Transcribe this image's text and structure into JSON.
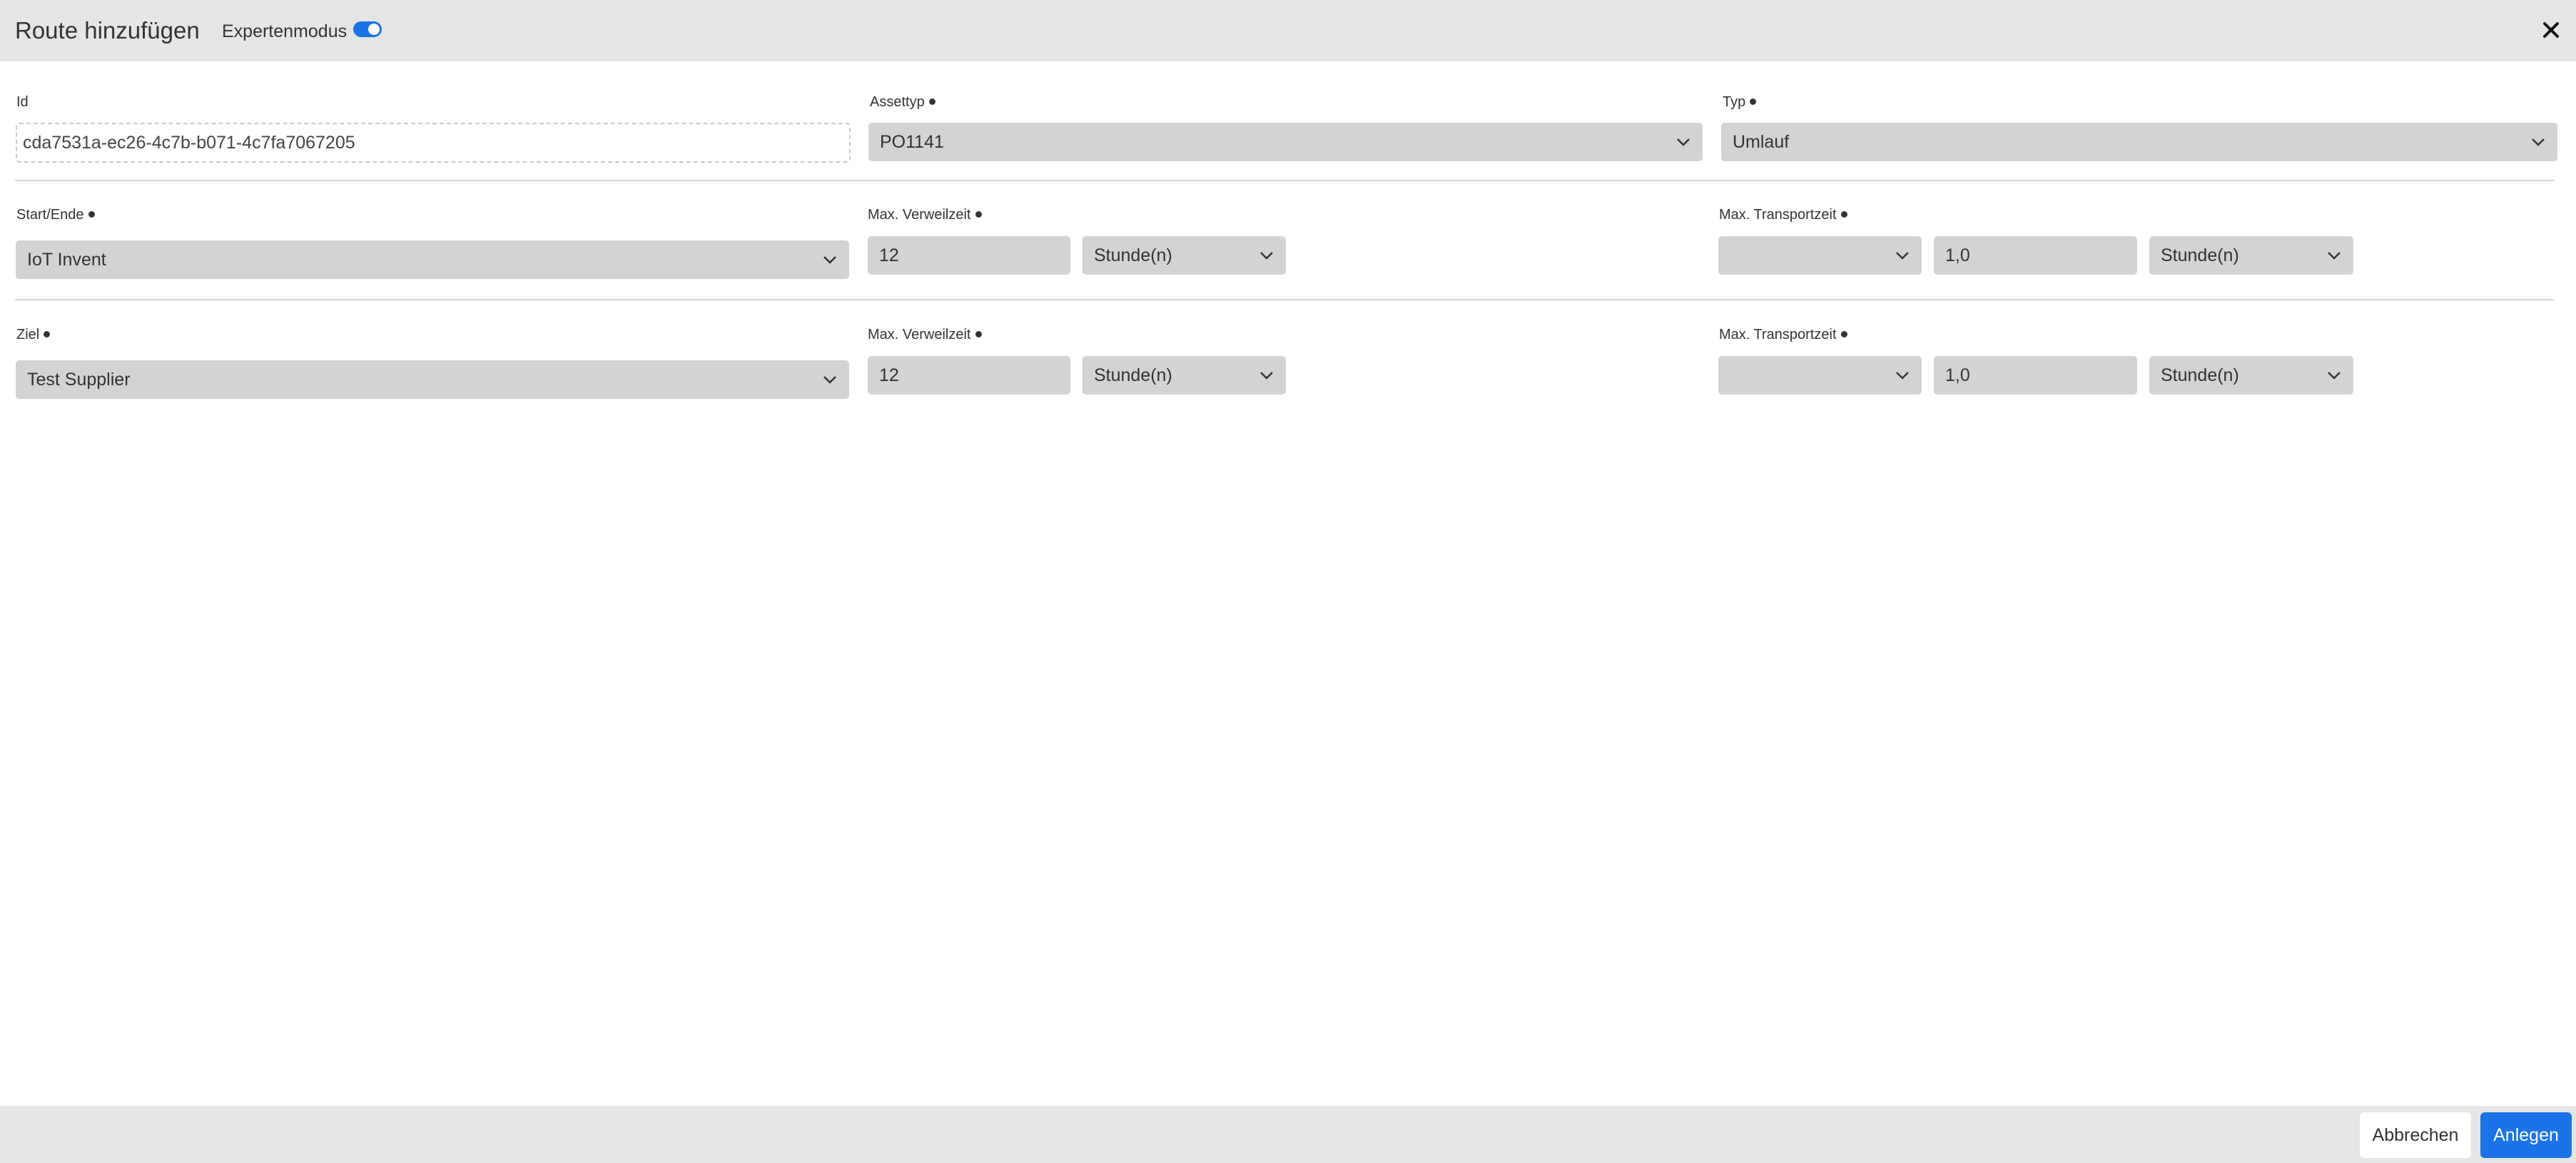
{
  "header": {
    "title": "Route hinzufügen",
    "expert_mode_label": "Expertenmodus",
    "expert_mode_on": true
  },
  "colors": {
    "accent": "#1a73e8",
    "header_bg": "#e5e5e5",
    "field_bg": "#d3d3d3"
  },
  "row1": {
    "id_label": "Id",
    "id_value": "cda7531a-ec26-4c7b-b071-4c7fa7067205",
    "assettyp_label": "Assettyp",
    "assettyp_value": "PO1141",
    "typ_label": "Typ",
    "typ_value": "Umlauf"
  },
  "row2": {
    "start_label": "Start/Ende",
    "start_value": "IoT Invent",
    "dwell_label": "Max. Verweilzeit",
    "dwell_value": "12",
    "dwell_unit": "Stunde(n)",
    "transport_label": "Max. Transportzeit",
    "transport_mode": "",
    "transport_value": "1,0",
    "transport_unit": "Stunde(n)"
  },
  "row3": {
    "target_label": "Ziel",
    "target_value": "Test Supplier",
    "dwell_label": "Max. Verweilzeit",
    "dwell_value": "12",
    "dwell_unit": "Stunde(n)",
    "transport_label": "Max. Transportzeit",
    "transport_mode": "",
    "transport_value": "1,0",
    "transport_unit": "Stunde(n)"
  },
  "footer": {
    "cancel_label": "Abbrechen",
    "create_label": "Anlegen"
  }
}
